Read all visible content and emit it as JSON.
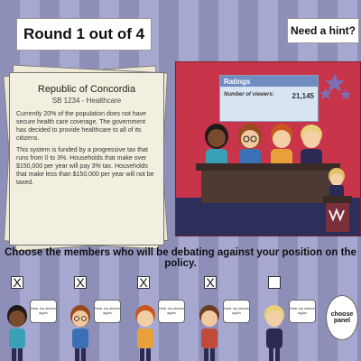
{
  "header": {
    "round_label": "Round 1 out of 4",
    "hint_label": "Need a hint?"
  },
  "policy_card": {
    "title": "Republic of Concordia",
    "subtitle": "SB 1234 - Healthcare",
    "paragraphs": [
      "Currently 20% of the population does not have secure health care coverage. The government has decided to provide healthcare to all of its citizens.",
      "This system is funded by a progressive tax that runs from 0 to 3%. Households that make over $150,000 per year will pay 3% tax. Households that make less than $150,000 per year will not be taxed."
    ]
  },
  "scene": {
    "ratings_title": "Ratings",
    "viewers_label": "Number of viewers:",
    "viewers_value": "21,145"
  },
  "prompt": "Choose the members who will be debating against your position on the policy.",
  "members": [
    {
      "checked": true,
      "mark": "X",
      "bubble": "Hear my stance again"
    },
    {
      "checked": true,
      "mark": "X",
      "bubble": "Hear my stance again"
    },
    {
      "checked": true,
      "mark": "X",
      "bubble": "Hear my stance again"
    },
    {
      "checked": true,
      "mark": "X",
      "bubble": "Hear my stance again"
    },
    {
      "checked": false,
      "mark": "",
      "bubble": "Hear my stance again"
    }
  ],
  "choose_panel_label": "choose panel",
  "colors": {
    "stripe_dark": "#8e8fb9",
    "stripe_light": "#a6a8cf",
    "scene_red": "#c8354a",
    "desk": "#4e3a33",
    "ratings_header": "#6f8dc1"
  }
}
